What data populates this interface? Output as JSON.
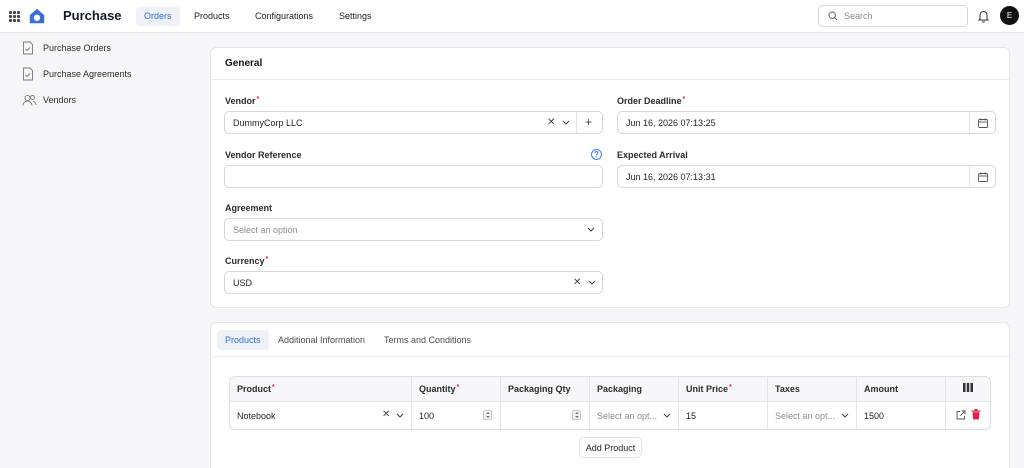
{
  "app": {
    "title": "Purchase",
    "avatar_initial": "E"
  },
  "topnav": [
    {
      "label": "Orders",
      "active": true
    },
    {
      "label": "Products",
      "active": false
    },
    {
      "label": "Configurations",
      "active": false
    },
    {
      "label": "Settings",
      "active": false
    }
  ],
  "search": {
    "placeholder": "Search"
  },
  "sidebar": {
    "items": [
      {
        "label": "Purchase Orders",
        "icon": "document-icon"
      },
      {
        "label": "Purchase Agreements",
        "icon": "document-icon"
      },
      {
        "label": "Vendors",
        "icon": "users-icon"
      }
    ]
  },
  "general": {
    "title": "General",
    "vendor": {
      "label": "Vendor",
      "value": "DummyCorp LLC"
    },
    "vendor_reference": {
      "label": "Vendor Reference",
      "value": ""
    },
    "agreement": {
      "label": "Agreement",
      "placeholder": "Select an option"
    },
    "currency": {
      "label": "Currency",
      "value": "USD"
    },
    "order_deadline": {
      "label": "Order Deadline",
      "value": "Jun 16, 2026 07:13:25"
    },
    "expected_arrival": {
      "label": "Expected Arrival",
      "value": "Jun 16, 2026 07:13:31"
    }
  },
  "tabs": [
    {
      "label": "Products",
      "active": true
    },
    {
      "label": "Additional Information",
      "active": false
    },
    {
      "label": "Terms and Conditions",
      "active": false
    }
  ],
  "products_table": {
    "columns": [
      "Product",
      "Quantity",
      "Packaging Qty",
      "Packaging",
      "Unit Price",
      "Taxes",
      "Amount"
    ],
    "rows": [
      {
        "product": "Notebook",
        "quantity": "100",
        "packaging_qty": "",
        "packaging": "Select an opt...",
        "unit_price": "15",
        "taxes": "Select an opt...",
        "amount": "1500"
      }
    ],
    "add_label": "Add Product"
  },
  "colors": {
    "accent": "#2f6fd6",
    "danger": "#e11d48"
  }
}
